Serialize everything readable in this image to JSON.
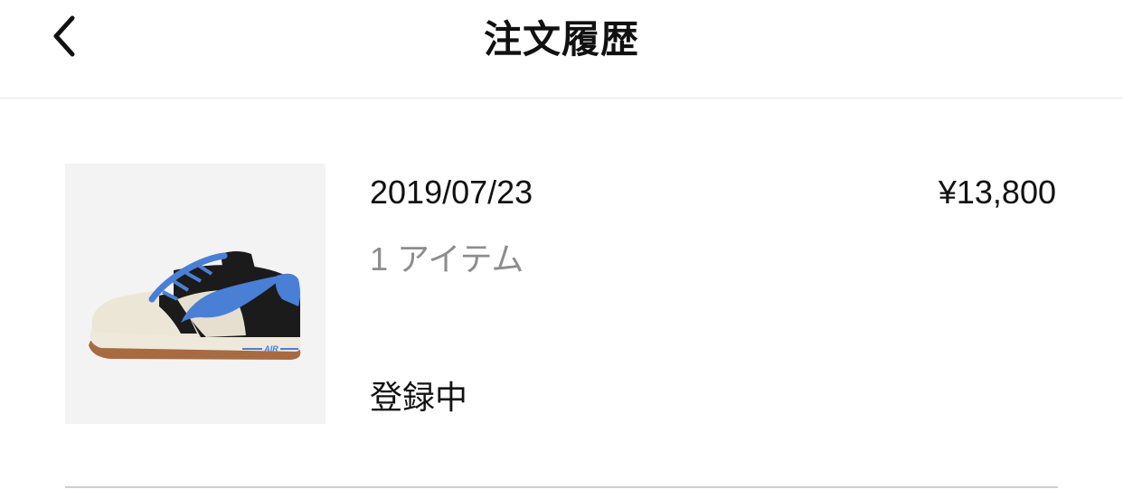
{
  "header": {
    "title": "注文履歴",
    "back_icon": "chevron-left-icon"
  },
  "orders": [
    {
      "date": "2019/07/23",
      "price": "¥13,800",
      "item_count": "1 アイテム",
      "status": "登録中",
      "product_image": "sneaker-image",
      "shoe_tongue_label": "AIR"
    }
  ],
  "colors": {
    "accent_blue": "#4a7fd6",
    "text_primary": "#111111",
    "text_secondary": "#8d8d8d",
    "thumb_bg": "#f3f3f3"
  }
}
